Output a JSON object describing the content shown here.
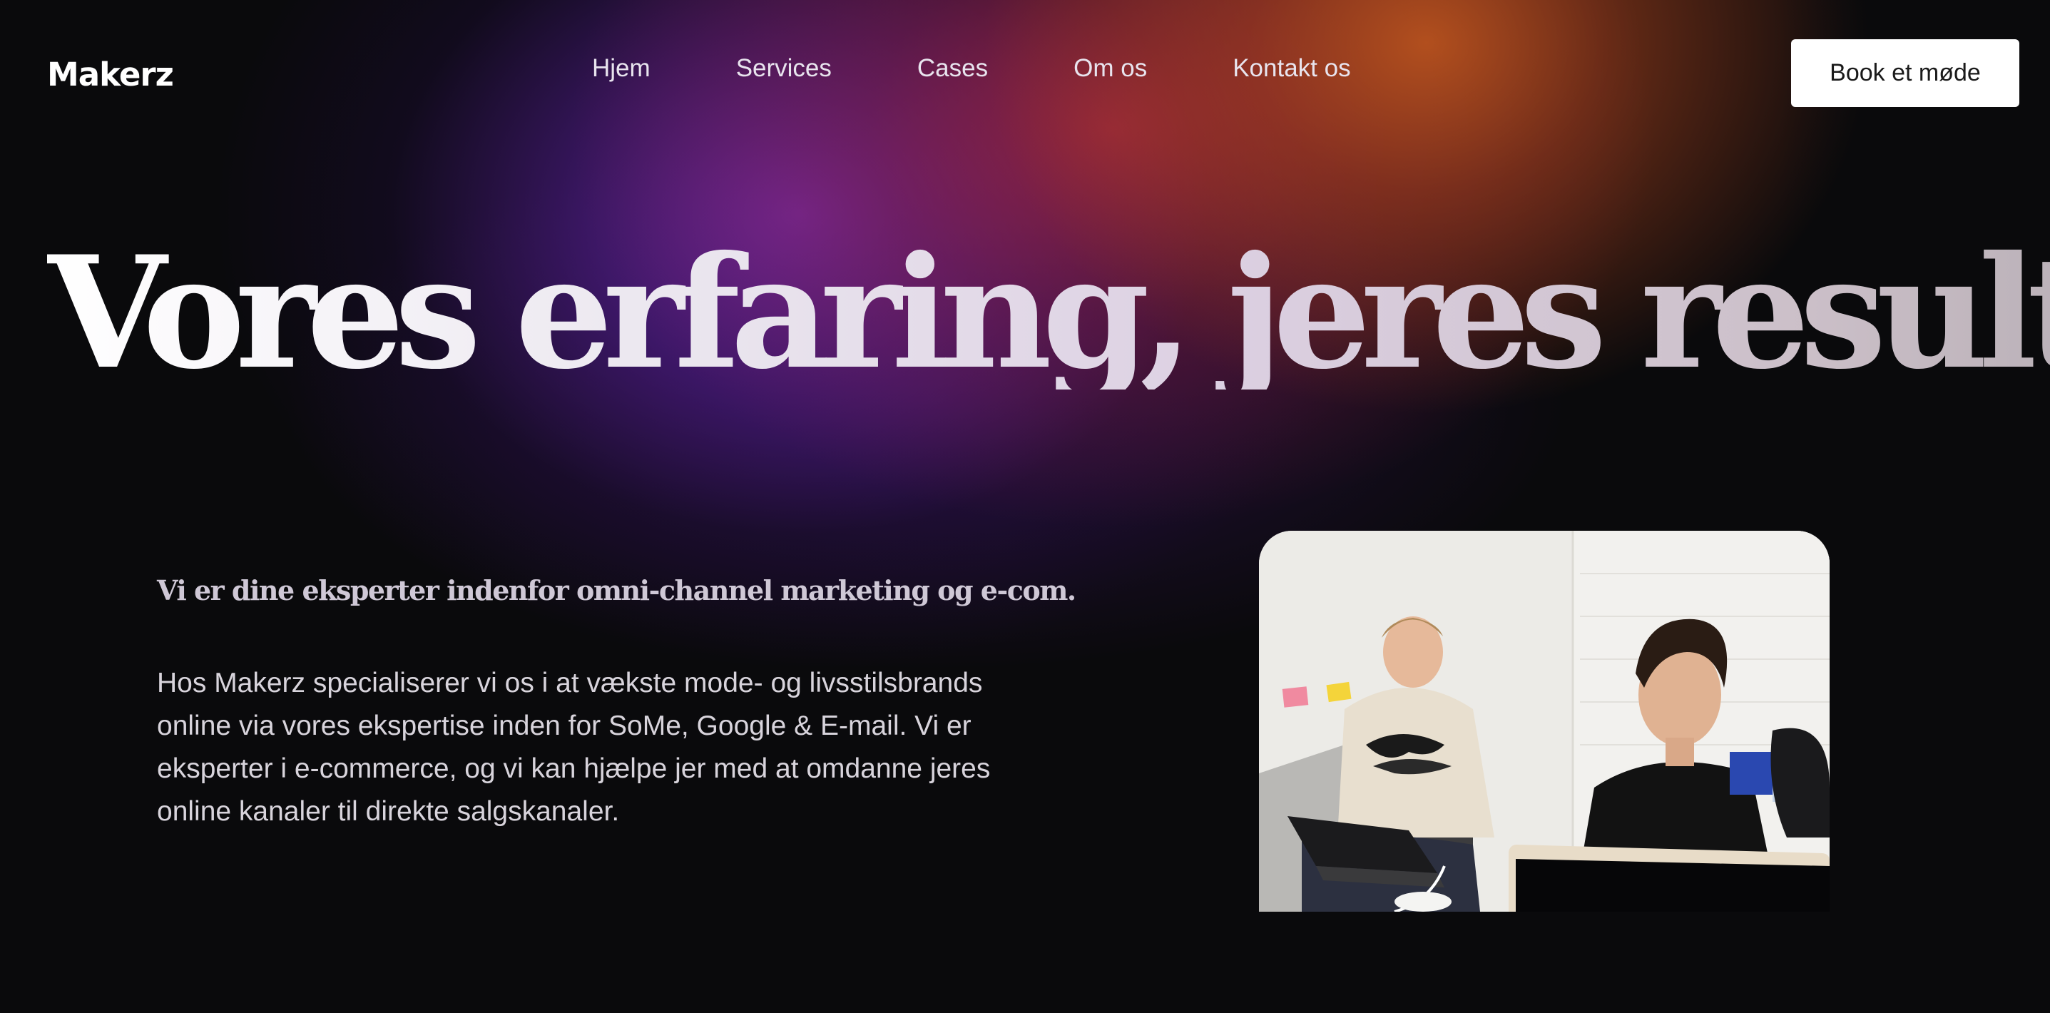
{
  "header": {
    "logo": "Makerz",
    "nav": [
      {
        "label": "Hjem"
      },
      {
        "label": "Services"
      },
      {
        "label": "Cases"
      },
      {
        "label": "Om os"
      },
      {
        "label": "Kontakt os"
      }
    ],
    "cta_label": "Book et møde"
  },
  "hero": {
    "title": "Vores erfaring, jeres resultater"
  },
  "intro": {
    "lead": "Vi er dine eksperter indenfor omni-channel marketing og e-com.",
    "body": "Hos Makerz specialiserer vi os i at vækste mode- og livsstilsbrands online via vores ekspertise inden for SoMe, Google & E-mail. Vi er eksperter i e-commerce, og vi kan hjælpe jer med at omdanne jeres online kanaler til direkte salgskanaler."
  },
  "colors": {
    "background": "#0a0a0c",
    "glow_purple": "#6e28aa",
    "glow_red": "#aa283c",
    "glow_orange": "#c85a1e",
    "cta_background": "#ffffff"
  }
}
